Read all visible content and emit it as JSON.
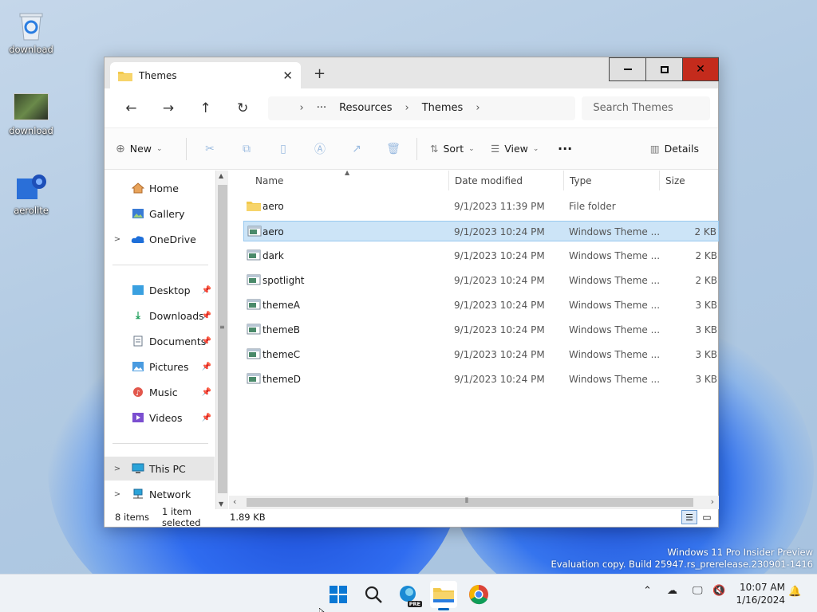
{
  "desktop": {
    "icons": [
      {
        "label": "download"
      },
      {
        "label": "download"
      },
      {
        "label": "aerolite"
      }
    ],
    "watermark_line1": "Windows 11 Pro Insider Preview",
    "watermark_line2": "Evaluation copy. Build 25947.rs_prerelease.230901-1416"
  },
  "window": {
    "tab_title": "Themes",
    "address": {
      "overflow": "···",
      "crumbs": [
        "Resources",
        "Themes"
      ]
    },
    "search_placeholder": "Search Themes",
    "commands": {
      "new": "New",
      "sort": "Sort",
      "view": "View",
      "more": "···",
      "details": "Details"
    },
    "sidebar": {
      "home": "Home",
      "gallery": "Gallery",
      "onedrive": "OneDrive",
      "desktop": "Desktop",
      "downloads": "Downloads",
      "documents": "Documents",
      "pictures": "Pictures",
      "music": "Music",
      "videos": "Videos",
      "thispc": "This PC",
      "network": "Network"
    },
    "columns": {
      "name": "Name",
      "date": "Date modified",
      "type": "Type",
      "size": "Size"
    },
    "files": [
      {
        "name": "aero",
        "date": "9/1/2023 11:39 PM",
        "type": "File folder",
        "size": ""
      },
      {
        "name": "aero",
        "date": "9/1/2023 10:24 PM",
        "type": "Windows Theme ...",
        "size": "2 KB"
      },
      {
        "name": "dark",
        "date": "9/1/2023 10:24 PM",
        "type": "Windows Theme ...",
        "size": "2 KB"
      },
      {
        "name": "spotlight",
        "date": "9/1/2023 10:24 PM",
        "type": "Windows Theme ...",
        "size": "2 KB"
      },
      {
        "name": "themeA",
        "date": "9/1/2023 10:24 PM",
        "type": "Windows Theme ...",
        "size": "3 KB"
      },
      {
        "name": "themeB",
        "date": "9/1/2023 10:24 PM",
        "type": "Windows Theme ...",
        "size": "3 KB"
      },
      {
        "name": "themeC",
        "date": "9/1/2023 10:24 PM",
        "type": "Windows Theme ...",
        "size": "3 KB"
      },
      {
        "name": "themeD",
        "date": "9/1/2023 10:24 PM",
        "type": "Windows Theme ...",
        "size": "3 KB"
      }
    ],
    "status": {
      "count": "8 items",
      "selected": "1 item selected",
      "size": "1.89 KB"
    }
  },
  "taskbar": {
    "time": "10:07 AM",
    "date": "1/16/2024",
    "edge_badge": "PRE"
  },
  "colors": {
    "accent": "#0067c0",
    "selection": "#cce4f7",
    "folder": "#f2c94c",
    "close": "#c42b1c"
  }
}
